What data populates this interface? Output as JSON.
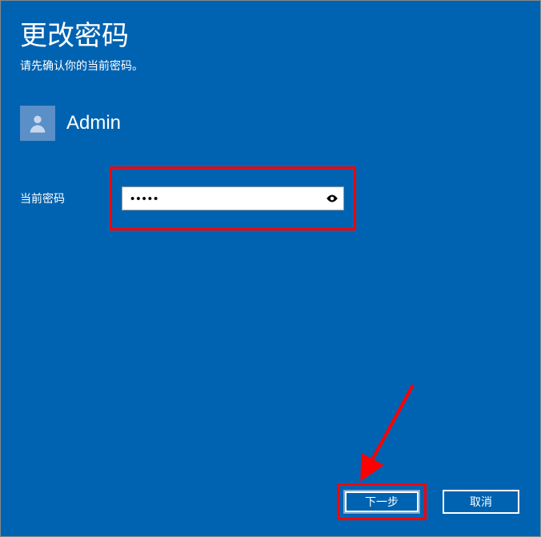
{
  "header": {
    "title": "更改密码",
    "subtitle": "请先确认你的当前密码。"
  },
  "user": {
    "name": "Admin"
  },
  "form": {
    "current_password_label": "当前密码",
    "current_password_value": "•••••"
  },
  "buttons": {
    "next": "下一步",
    "cancel": "取消"
  },
  "icons": {
    "avatar": "user-icon",
    "reveal": "eye-icon"
  },
  "annotations": {
    "highlight_color": "#FF0000",
    "arrow_color": "#FF0000"
  }
}
